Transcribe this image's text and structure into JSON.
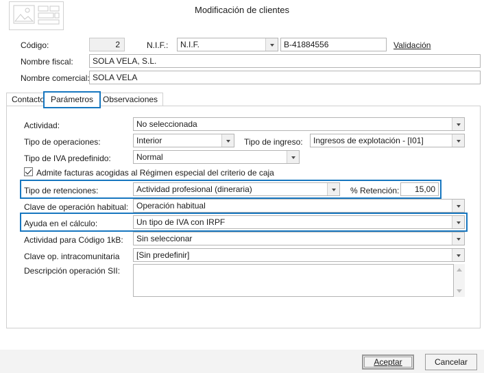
{
  "window": {
    "title": "Modificación de clientes",
    "icon": "contact-card-icon"
  },
  "header_fields": {
    "codigo_label": "Código:",
    "codigo_value": "2",
    "nif_label": "N.I.F.:",
    "nif_type_value": "N.I.F.",
    "nif_value": "B-41884556",
    "validacion_link": "Validación",
    "nombre_fiscal_label": "Nombre fiscal:",
    "nombre_fiscal_value": "SOLA VELA, S.L.",
    "nombre_comercial_label": "Nombre comercial:",
    "nombre_comercial_value": "SOLA VELA"
  },
  "tabs": [
    {
      "label": "Contacto",
      "active": false
    },
    {
      "label": "Parámetros",
      "active": true
    },
    {
      "label": "Observaciones",
      "active": false
    }
  ],
  "parametros": {
    "actividad": {
      "label": "Actividad:",
      "value": "No seleccionada"
    },
    "tipo_operaciones": {
      "label": "Tipo de operaciones:",
      "value": "Interior"
    },
    "tipo_ingreso": {
      "label": "Tipo de ingreso:",
      "value": "Ingresos de explotación - [I01]"
    },
    "tipo_iva": {
      "label": "Tipo de IVA predefinido:",
      "value": "Normal"
    },
    "criterio_caja": {
      "label": "Admite facturas acogidas al Régimen especial del criterio de caja",
      "checked": true
    },
    "tipo_retenciones": {
      "label": "Tipo de retenciones:",
      "value": "Actividad profesional (dineraria)",
      "highlighted": true
    },
    "pct_retencion": {
      "label": "% Retención:",
      "value": "15,00"
    },
    "clave_operacion": {
      "label": "Clave de operación habitual:",
      "value": "Operación habitual"
    },
    "ayuda_calculo": {
      "label": "Ayuda en el cálculo:",
      "value": "Un tipo de IVA con IRPF",
      "highlighted": true
    },
    "actividad_1kb": {
      "label": "Actividad para Código 1kB:",
      "value": "Sin seleccionar"
    },
    "clave_intracomunitaria": {
      "label": "Clave op. intracomunitaria",
      "value": "[Sin predefinir]"
    },
    "descripcion_sii": {
      "label": "Descripción operación SII:",
      "value": ""
    }
  },
  "footer": {
    "accept_label": "Aceptar",
    "cancel_label": "Cancelar"
  },
  "colors": {
    "highlight": "#1676bf",
    "footer_bg": "#f3f3f3",
    "field_border": "#b4b4b4"
  }
}
